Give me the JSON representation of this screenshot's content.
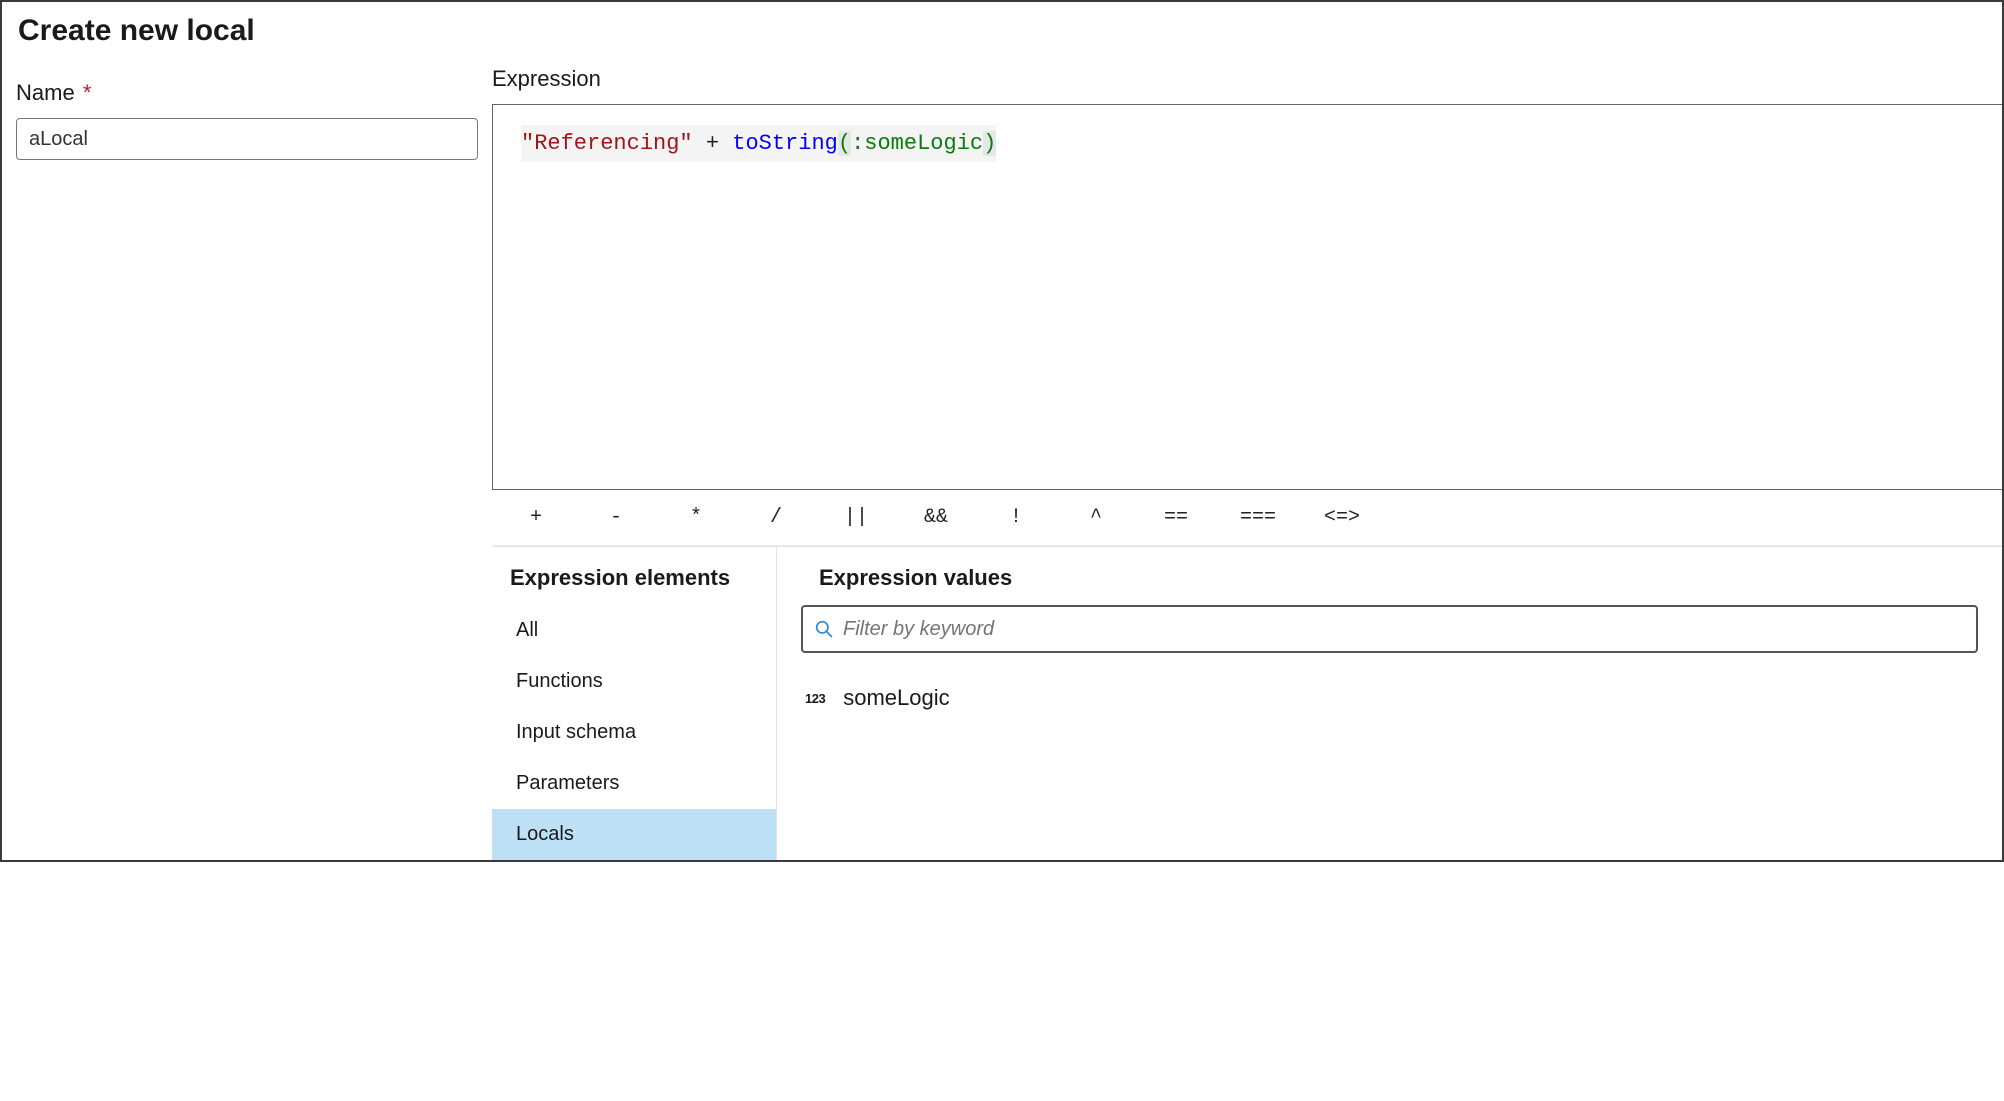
{
  "page_title": "Create new local",
  "name_field": {
    "label": "Name",
    "required_marker": "*",
    "value": "aLocal"
  },
  "expression": {
    "label": "Expression",
    "tokens": {
      "str": "\"Referencing\"",
      "plus": " + ",
      "fn": "toString",
      "lpar": "(",
      "param": ":someLogic",
      "rpar": ")"
    }
  },
  "operators": [
    "+",
    "-",
    "*",
    "/",
    "||",
    "&&",
    "!",
    "^",
    "==",
    "===",
    "<=>"
  ],
  "operators_active_index": 8,
  "elements": {
    "title": "Expression elements",
    "items": [
      "All",
      "Functions",
      "Input schema",
      "Parameters",
      "Locals"
    ],
    "selected_index": 4
  },
  "values": {
    "title": "Expression values",
    "search_placeholder": "Filter by keyword",
    "items": [
      {
        "type_badge": "123",
        "label": "someLogic"
      }
    ]
  }
}
